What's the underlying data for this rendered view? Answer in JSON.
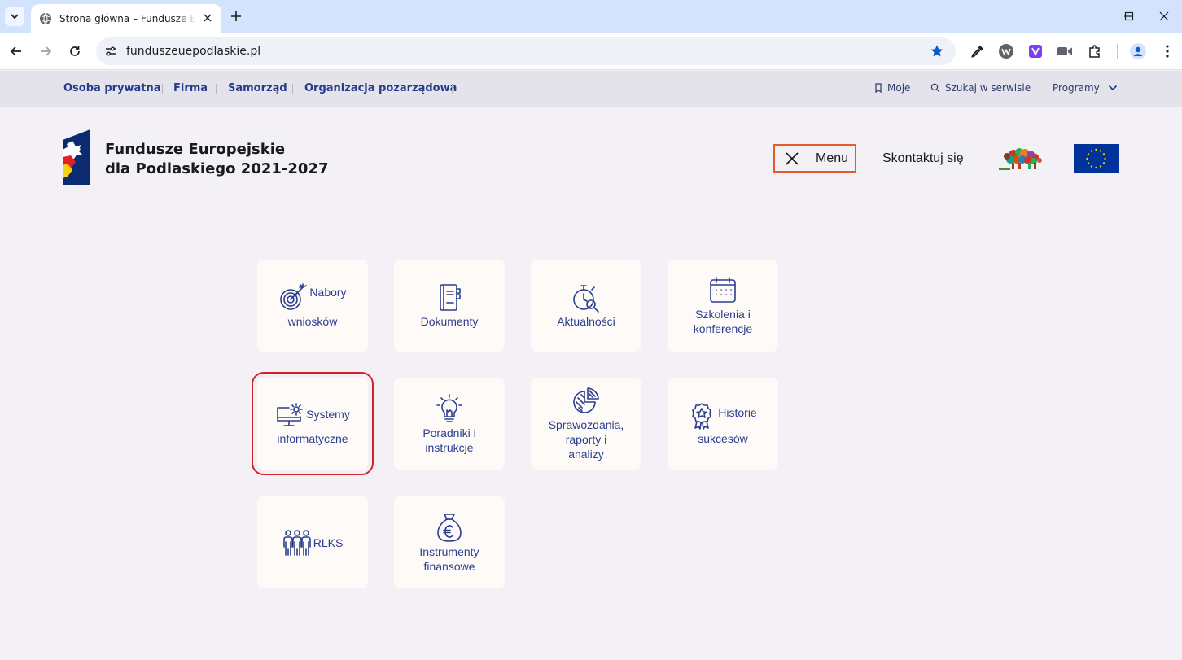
{
  "browser": {
    "tab_title": "Strona główna – Fundusze Europejskie dla Podlaskiego",
    "url": "funduszeuepodlaskie.pl",
    "accent": "#d3e3fd"
  },
  "site": {
    "audience_nav": [
      "Osoba prywatna",
      "Firma",
      "Samorząd",
      "Organizacja pozarządowa"
    ],
    "utility": {
      "moje": "Moje",
      "search": "Szukaj w serwisie",
      "programs": "Programy"
    },
    "brand_line1": "Fundusze Europejskie",
    "brand_line2": "dla Podlaskiego 2021-2027",
    "menu_label": "Menu",
    "contact": "Skontaktuj się",
    "colors": {
      "nav_text": "#233d8c",
      "menu_border": "#e65b2a",
      "highlight": "#d8202a",
      "eu_blue": "#003399"
    }
  },
  "tiles": [
    {
      "name": "nabory",
      "line1": "Nabory",
      "line2": "wniosków",
      "icon": "target-icon"
    },
    {
      "name": "dokumenty",
      "line1": "Dokumenty",
      "icon": "notebook-icon"
    },
    {
      "name": "aktualnosci",
      "line1": "Aktualności",
      "icon": "stopwatch-search-icon"
    },
    {
      "name": "szkolenia",
      "line1": "Szkolenia i",
      "line2": "konferencje",
      "icon": "calendar-icon"
    },
    {
      "name": "systemy",
      "line1": "Systemy",
      "line2": "informatyczne",
      "icon": "monitor-gear-icon"
    },
    {
      "name": "poradniki",
      "line1": "Poradniki i",
      "line2": "instrukcje",
      "icon": "lightbulb-icon"
    },
    {
      "name": "sprawozdania",
      "line1": "Sprawozdania,",
      "line2": "raporty i",
      "line3": "analizy",
      "icon": "pie-chart-icon"
    },
    {
      "name": "historie",
      "line1": "Historie",
      "line2": "sukcesów",
      "icon": "award-icon"
    },
    {
      "name": "rlks",
      "line1": "RLKS",
      "icon": "people-icon"
    },
    {
      "name": "instrumenty",
      "line1": "Instrumenty",
      "line2": "finansowe",
      "icon": "money-bag-icon"
    }
  ]
}
